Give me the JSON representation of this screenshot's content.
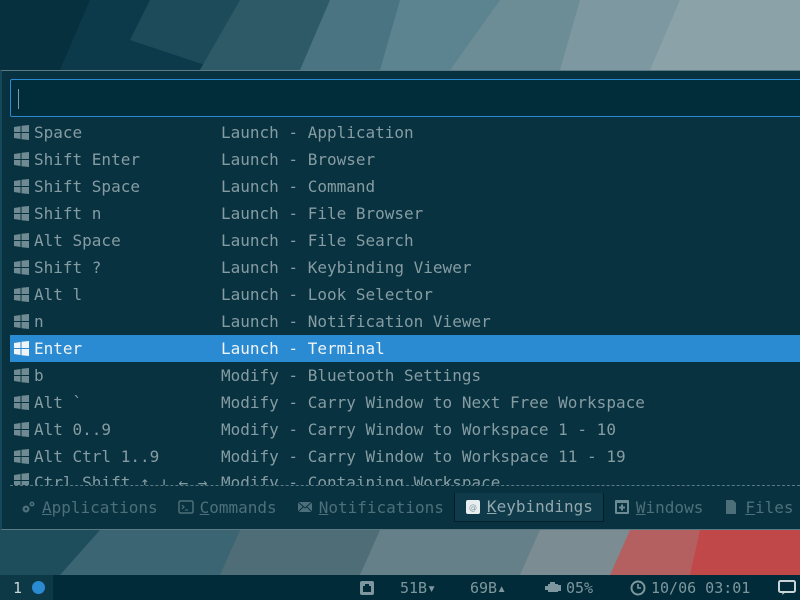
{
  "colors": {
    "accent": "#2a8ad2",
    "panel_bg": "#083240",
    "text_dim": "#869ca3",
    "text_selected": "#f0f4f6",
    "statusbar_bg": "#012b38"
  },
  "search": {
    "value": "",
    "placeholder": ""
  },
  "keybindings": [
    {
      "icon": "windows-key-icon",
      "key": "Space",
      "action": "Launch - Application"
    },
    {
      "icon": "windows-key-icon",
      "key": "Shift Enter",
      "action": "Launch - Browser"
    },
    {
      "icon": "windows-key-icon",
      "key": "Shift Space",
      "action": "Launch - Command"
    },
    {
      "icon": "windows-key-icon",
      "key": "Shift n",
      "action": "Launch - File Browser"
    },
    {
      "icon": "windows-key-icon",
      "key": "Alt Space",
      "action": "Launch - File Search"
    },
    {
      "icon": "windows-key-icon",
      "key": "Shift ?",
      "action": "Launch - Keybinding Viewer"
    },
    {
      "icon": "windows-key-icon",
      "key": "Alt l",
      "action": "Launch - Look Selector"
    },
    {
      "icon": "windows-key-icon",
      "key": "n",
      "action": "Launch - Notification Viewer"
    },
    {
      "icon": "windows-key-icon",
      "key": "Enter",
      "action": "Launch - Terminal",
      "selected": true
    },
    {
      "icon": "windows-key-icon",
      "key": "b",
      "action": "Modify - Bluetooth Settings"
    },
    {
      "icon": "windows-key-icon",
      "key": "Alt `",
      "action": "Modify - Carry Window to Next Free Workspace"
    },
    {
      "icon": "windows-key-icon",
      "key": "Alt 0..9",
      "action": "Modify - Carry Window to Workspace 1 - 10"
    },
    {
      "icon": "windows-key-icon",
      "key": "Alt Ctrl 1..9",
      "action": "Modify - Carry Window to Workspace 11 - 19"
    },
    {
      "icon": "windows-key-icon",
      "key": "Ctrl Shift ↑ ↓ ← →",
      "action": "Modify - Containing Workspace"
    }
  ],
  "tabs": [
    {
      "icon": "gears-icon",
      "mnemonic": "A",
      "rest": "pplications",
      "active": false
    },
    {
      "icon": "terminal-icon",
      "mnemonic": "C",
      "rest": "ommands",
      "active": false
    },
    {
      "icon": "envelope-icon",
      "mnemonic": "N",
      "rest": "otifications",
      "active": false
    },
    {
      "icon": "keybinding-icon",
      "mnemonic": "K",
      "rest": "eybindings",
      "active": true
    },
    {
      "icon": "window-plus-icon",
      "mnemonic": "W",
      "rest": "indows",
      "active": false
    },
    {
      "icon": "file-icon",
      "mnemonic": "F",
      "rest": "iles",
      "active": false
    }
  ],
  "statusbar": {
    "workspace": "1",
    "net_down": "51B",
    "net_up": "69B",
    "cpu": "05%",
    "datetime": "10/06 03:01"
  }
}
